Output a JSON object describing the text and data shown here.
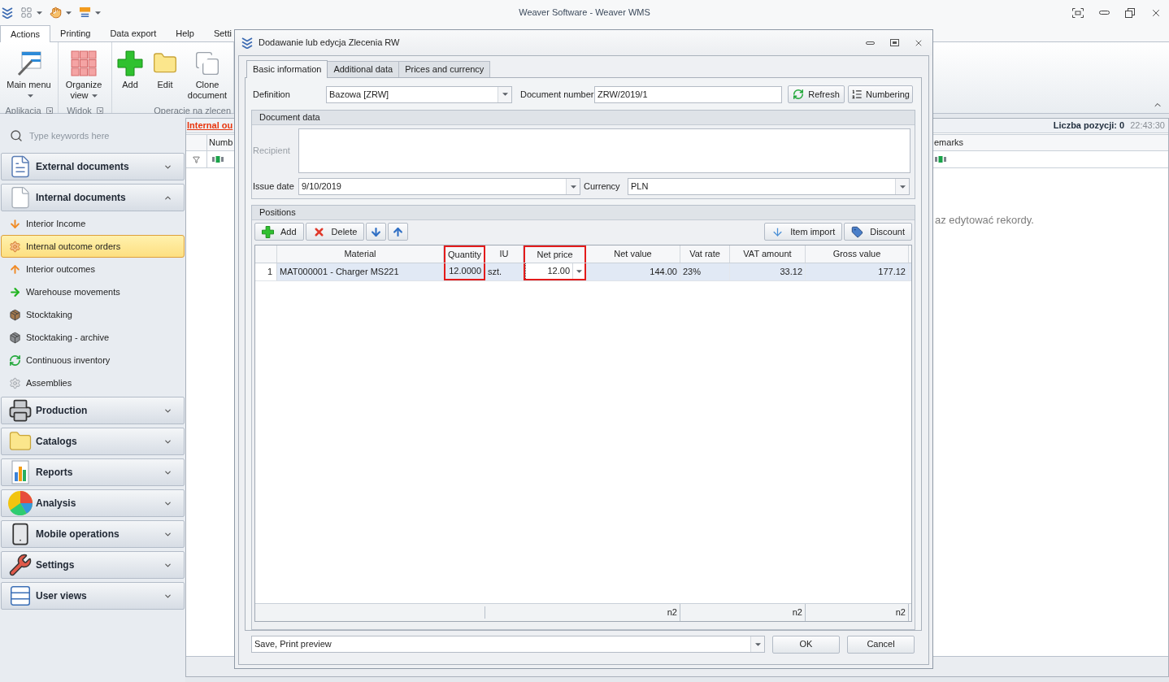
{
  "window": {
    "title": "Weaver Software - Weaver WMS"
  },
  "ribbon": {
    "tabs": [
      {
        "label": "Actions",
        "selected": true
      },
      {
        "label": "Printing",
        "selected": false
      },
      {
        "label": "Data export",
        "selected": false
      },
      {
        "label": "Help",
        "selected": false
      },
      {
        "label": "Setti",
        "selected": false
      }
    ],
    "groups": [
      {
        "label": "Aplikacja",
        "launcher": true,
        "buttons": [
          {
            "label": "Main menu",
            "dropdown": true
          }
        ]
      },
      {
        "label": "Widok",
        "launcher": true,
        "buttons": [
          {
            "label": "Organize view",
            "dropdown": true
          }
        ]
      },
      {
        "label": "Operacje na zlecen",
        "buttons": [
          {
            "label": "Add",
            "dropdown": false
          },
          {
            "label": "Edit",
            "dropdown": false
          },
          {
            "label": "Clone document",
            "dropdown": false
          }
        ]
      }
    ]
  },
  "sidebar": {
    "search": {
      "placeholder": "Type keywords here"
    },
    "groups": [
      {
        "label": "External documents",
        "expanded": false
      },
      {
        "label": "Internal documents",
        "expanded": true,
        "items": [
          {
            "label": "Interior Income",
            "selected": false
          },
          {
            "label": "Internal outcome orders",
            "selected": true
          },
          {
            "label": "Interior outcomes",
            "selected": false
          },
          {
            "label": "Warehouse movements",
            "selected": false
          },
          {
            "label": "Stocktaking",
            "selected": false
          },
          {
            "label": "Stocktaking - archive",
            "selected": false
          },
          {
            "label": "Continuous inventory",
            "selected": false
          },
          {
            "label": "Assemblies",
            "selected": false
          }
        ]
      },
      {
        "label": "Production",
        "expanded": false
      },
      {
        "label": "Catalogs",
        "expanded": false
      },
      {
        "label": "Reports",
        "expanded": false
      },
      {
        "label": "Analysis",
        "expanded": false
      },
      {
        "label": "Mobile operations",
        "expanded": false
      },
      {
        "label": "Settings",
        "expanded": false
      },
      {
        "label": "User views",
        "expanded": false
      }
    ]
  },
  "document_list": {
    "title": "Internal ou",
    "count": "Liczba pozycji: 0",
    "time": "22:43:30",
    "columns": [
      {
        "label": "Numb"
      },
      {
        "label": "emarks"
      }
    ],
    "empty_message": "az edytować rekordy."
  },
  "dialog": {
    "title": "Dodawanie lub edycja Zlecenia RW",
    "tabs": [
      {
        "label": "Basic information",
        "selected": true
      },
      {
        "label": "Additional data",
        "selected": false
      },
      {
        "label": "Prices and currency",
        "selected": false
      }
    ],
    "definition": {
      "label": "Definition",
      "value": "Bazowa [ZRW]"
    },
    "document_number": {
      "label": "Document number",
      "value": "ZRW/2019/1"
    },
    "actions": [
      {
        "label": "Refresh"
      },
      {
        "label": "Numbering"
      }
    ],
    "document_data": {
      "title": "Document data",
      "recipient": {
        "label": "Recipient",
        "disabled": true
      },
      "issue_date": {
        "label": "Issue date",
        "value": "9/10/2019"
      },
      "currency": {
        "label": "Currency",
        "value": "PLN"
      }
    },
    "positions": {
      "title": "Positions",
      "toolbar": [
        {
          "kind": "add",
          "label": "Add"
        },
        {
          "kind": "delete",
          "label": "Delete"
        },
        {
          "kind": "move_down"
        },
        {
          "kind": "move_up"
        }
      ],
      "toolbar_right": [
        {
          "kind": "import",
          "label": "Item import"
        },
        {
          "kind": "discount",
          "label": "Discount"
        }
      ],
      "columns": [
        {
          "label": "Material",
          "highlighted": false,
          "editing": false
        },
        {
          "label": "Quantity",
          "highlighted": true,
          "editing": false
        },
        {
          "label": "IU",
          "highlighted": false,
          "editing": false
        },
        {
          "label": "Net price",
          "highlighted": true,
          "editing": true
        },
        {
          "label": "Net value",
          "highlighted": false,
          "editing": false,
          "summary": "n2"
        },
        {
          "label": "Vat rate",
          "highlighted": false,
          "editing": false
        },
        {
          "label": "VAT amount",
          "highlighted": false,
          "editing": false,
          "summary": "n2"
        },
        {
          "label": "Gross value",
          "highlighted": false,
          "editing": false,
          "summary": "n2"
        }
      ],
      "rows": [
        {
          "number": "1",
          "selected": true,
          "cells": [
            "MAT000001 - Charger MS221",
            "12.0000",
            "szt.",
            "12.00",
            "144.00",
            "23%",
            "33.12",
            "177.12"
          ]
        }
      ]
    },
    "action_combo": {
      "value": "Save, Print preview"
    },
    "buttons": [
      {
        "label": "OK"
      },
      {
        "label": "Cancel"
      }
    ]
  }
}
